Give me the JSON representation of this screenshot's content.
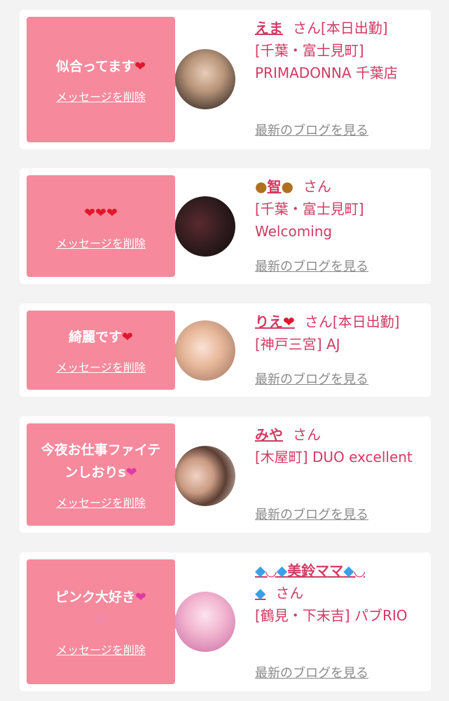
{
  "cards": [
    {
      "message": "似合ってます",
      "delete_label": "メッセージを削除",
      "name": "えま",
      "san": "さん[本日出勤]",
      "shop": "[千葉・富士見町] PRIMADONNA 千葉店",
      "blog_label": "最新のブログを見る"
    },
    {
      "message": "",
      "delete_label": "メッセージを削除",
      "name": "智",
      "san": "さん",
      "shop": "[千葉・富士見町] Welcoming",
      "blog_label": "最新のブログを見る"
    },
    {
      "message": "綺麗です",
      "delete_label": "メッセージを削除",
      "name": "りえ",
      "san": "さん[本日出勤]",
      "shop": "[神戸三宮] AJ",
      "blog_label": "最新のブログを見る"
    },
    {
      "message": "今夜お仕事ファイテンしおりs",
      "delete_label": "メッセージを削除",
      "name": "みや",
      "san": "さん",
      "shop": "[木屋町] DUO excellent",
      "blog_label": "最新のブログを見る"
    },
    {
      "message": "ピンク大好き",
      "delete_label": "メッセージを削除",
      "name": "美鈴ママ",
      "san": "さん",
      "shop": "[鶴見・下末吉] パブRIO",
      "blog_label": "最新のブログを見る"
    }
  ],
  "icons": {
    "heart": "heart-icon",
    "bear": "bear-icon",
    "gem": "gem-icon",
    "bra": "bra-icon",
    "flower": "flower-icon",
    "sparkle_heart": "sparkle-heart-icon"
  },
  "colors": {
    "bubble": "#f7899c",
    "accent": "#d23a63",
    "link_gray": "#8a8a8a"
  }
}
